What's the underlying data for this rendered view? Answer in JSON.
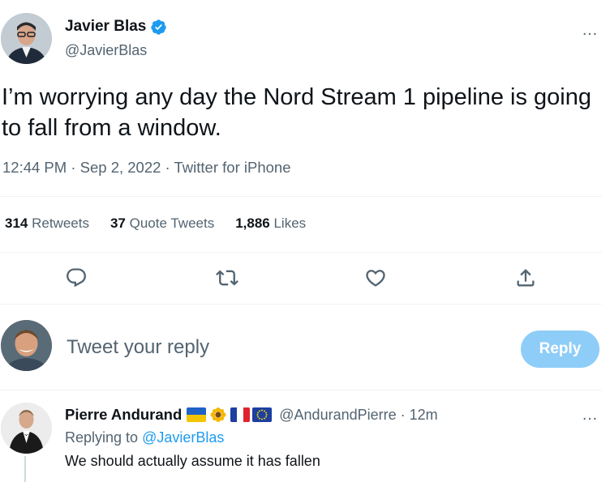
{
  "tweet": {
    "author_name": "Javier Blas",
    "author_handle": "@JavierBlas",
    "more_icon": "…",
    "text": "I’m worrying any day the Nord Stream 1 pipeline is going to fall from a window.",
    "time": "12:44 PM",
    "separator": " · ",
    "date": "Sep 2, 2022",
    "source": "Twitter for iPhone"
  },
  "stats": {
    "retweets_count": "314",
    "retweets_label": " Retweets",
    "quotes_count": "37",
    "quotes_label": " Quote Tweets",
    "likes_count": "1,886",
    "likes_label": " Likes"
  },
  "actions": [
    "reply-icon",
    "retweet-icon",
    "like-icon",
    "share-icon"
  ],
  "reply_composer": {
    "placeholder": "Tweet your reply",
    "button_label": "Reply",
    "button_color": "#8ecdf8"
  },
  "comment": {
    "author_name": "Pierre Andurand",
    "author_handle": "@AndurandPierre",
    "separator": " · ",
    "time_ago": "12m",
    "replying_prefix": "Replying to ",
    "replying_to": "@JavierBlas",
    "text": "We should actually assume it has fallen",
    "flags": [
      "ukraine-flag",
      "sunflower-emoji",
      "france-flag",
      "eu-flag"
    ]
  },
  "colors": {
    "text_primary": "#0f1419",
    "text_secondary": "#536471",
    "accent": "#1d9bf0",
    "divider": "#eff3f4"
  }
}
